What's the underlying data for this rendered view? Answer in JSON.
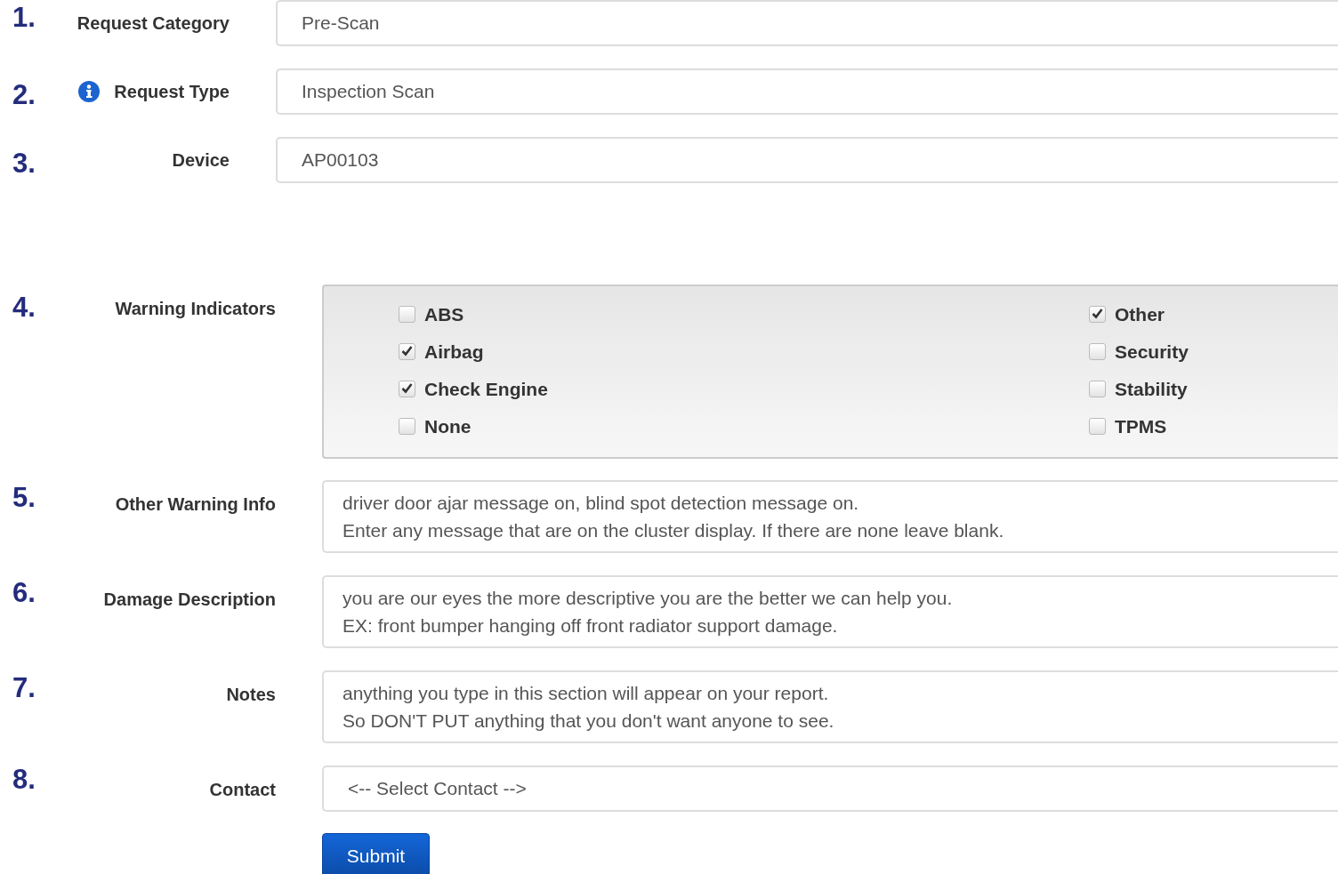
{
  "top_fields": [
    {
      "number": "1.",
      "label": "Request Category",
      "info": false,
      "value": "Pre-Scan"
    },
    {
      "number": "2.",
      "label": "Request Type",
      "info": true,
      "value": "Inspection Scan"
    },
    {
      "number": "3.",
      "label": "Device",
      "info": false,
      "value": "AP00103"
    }
  ],
  "detail_fields": [
    {
      "kind": "checkboxes",
      "number": "4.",
      "label": "Warning Indicators",
      "columns": [
        [
          {
            "label": "ABS",
            "checked": false
          },
          {
            "label": "Airbag",
            "checked": true
          },
          {
            "label": "Check Engine",
            "checked": true
          },
          {
            "label": "None",
            "checked": false
          }
        ],
        [
          {
            "label": "Other",
            "checked": true
          },
          {
            "label": "Security",
            "checked": false
          },
          {
            "label": "Stability",
            "checked": false
          },
          {
            "label": "TPMS",
            "checked": false
          }
        ]
      ]
    },
    {
      "kind": "textarea",
      "number": "5.",
      "label": "Other Warning Info",
      "lines": [
        "driver door ajar message on, blind spot detection message on.",
        "Enter any message that are on the cluster display. If there are none leave blank."
      ]
    },
    {
      "kind": "textarea",
      "number": "6.",
      "label": "Damage Description",
      "lines": [
        "you are our eyes the more descriptive you are the better we can help you.",
        "EX: front bumper hanging off front radiator support damage."
      ]
    },
    {
      "kind": "textarea",
      "number": "7.",
      "label": "Notes",
      "lines": [
        "anything you type in this section will appear on your report.",
        "So DON'T PUT anything that you don't want anyone to see."
      ]
    },
    {
      "kind": "select",
      "number": "8.",
      "label": "Contact",
      "value": "<-- Select Contact -->"
    }
  ],
  "submit": "Submit"
}
